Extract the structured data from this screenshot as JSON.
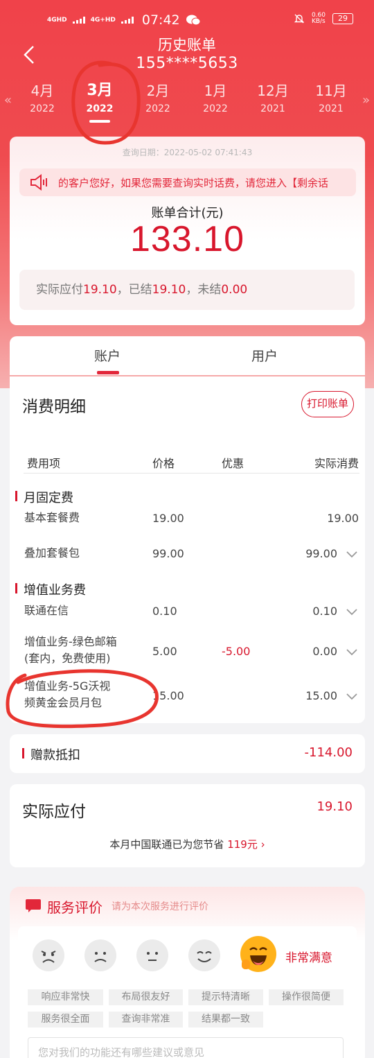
{
  "status_bar": {
    "net1": "4GHD",
    "net2": "4G+HD",
    "time": "07:42",
    "speed": "0.60",
    "speed_unit": "KB/s",
    "battery": "29"
  },
  "header": {
    "title": "历史账单",
    "phone": "155****5653"
  },
  "months": [
    {
      "month": "4月",
      "year": "2022"
    },
    {
      "month": "3月",
      "year": "2022",
      "active": true
    },
    {
      "month": "2月",
      "year": "2022"
    },
    {
      "month": "1月",
      "year": "2022"
    },
    {
      "month": "12月",
      "year": "2021"
    },
    {
      "month": "11月",
      "year": "2021"
    }
  ],
  "bill": {
    "query_date": "查询日期：2022-05-02 07:41:43",
    "notice": "的客户您好，如果您需要查询实时话费，请您进入【剩余话",
    "total_label": "账单合计(元)",
    "total_value": "133.10",
    "pay_label1": "实际应付",
    "pay_value1": "19.10",
    "pay_label2": "，已结",
    "pay_value2": "19.10",
    "pay_label3": "，未结",
    "pay_value3": "0.00"
  },
  "tabs": {
    "account": "账户",
    "user": "用户"
  },
  "detail": {
    "title": "消费明细",
    "print": "打印账单",
    "headers": {
      "item": "费用项",
      "price": "价格",
      "discount": "优惠",
      "actual": "实际消费"
    },
    "sections": [
      {
        "name": "月固定费",
        "rows": [
          {
            "name1": "基本套餐费",
            "name2": "",
            "price": "19.00",
            "discount": "",
            "actual": "19.00"
          },
          {
            "name1": "叠加套餐包",
            "name2": "",
            "price": "99.00",
            "discount": "",
            "actual": "99.00"
          }
        ]
      },
      {
        "name": "增值业务费",
        "rows": [
          {
            "name1": "联通在信",
            "name2": "",
            "price": "0.10",
            "discount": "",
            "actual": "0.10"
          },
          {
            "name1": "增值业务-绿色邮箱",
            "name2": "(套内，免费使用)",
            "price": "5.00",
            "discount": "-5.00",
            "actual": "0.00"
          },
          {
            "name1": "增值业务-5G沃视",
            "name2": "频黄金会员月包",
            "price": "15.00",
            "discount": "",
            "actual": "15.00"
          }
        ]
      }
    ]
  },
  "deduct": {
    "label": "赠款抵扣",
    "value": "-114.00"
  },
  "actual": {
    "title": "实际应付",
    "value": "19.10",
    "save_prefix": "本月中国联通已为您节省",
    "save_value": "119元",
    "save_arrow": "›"
  },
  "rating": {
    "title": "服务评价",
    "subtitle": "请为本次服务进行评价",
    "level": "非常满意",
    "chips": [
      "响应非常快",
      "布局很友好",
      "提示特清晰",
      "操作很简便",
      "服务很全面",
      "查询非常准",
      "结果都一致"
    ],
    "suggest_placeholder": "您对我们的功能还有哪些建议或意见"
  },
  "colors": {
    "brand": "#e2273a",
    "accent_red": "#d8162c",
    "annotation": "#e8352f"
  }
}
